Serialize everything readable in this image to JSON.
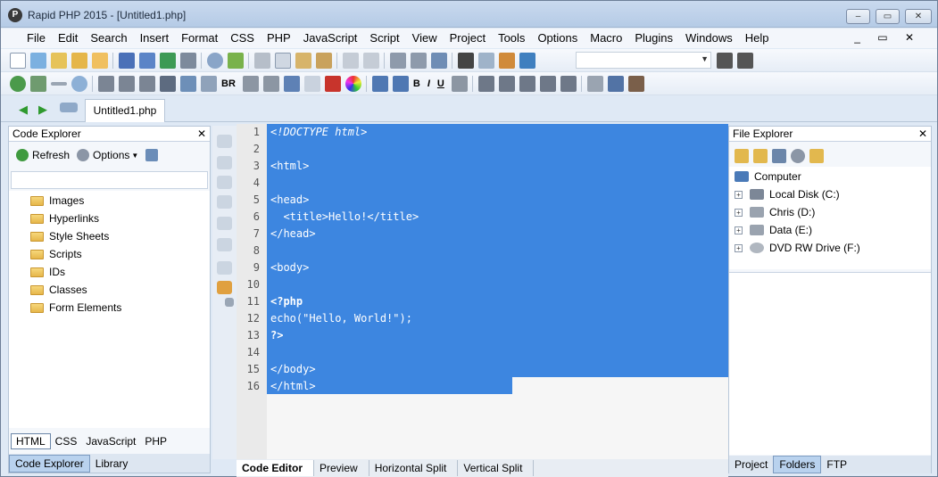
{
  "window": {
    "title": "Rapid PHP 2015 - [Untitled1.php]",
    "app_icon_letter": "P"
  },
  "window_controls": {
    "minimize": "–",
    "maximize": "▭",
    "close": "✕"
  },
  "menu": [
    "File",
    "Edit",
    "Search",
    "Insert",
    "Format",
    "CSS",
    "PHP",
    "JavaScript",
    "Script",
    "View",
    "Project",
    "Tools",
    "Options",
    "Macro",
    "Plugins",
    "Windows",
    "Help"
  ],
  "mdi_controls": "_ ▭ ✕",
  "toolbar2_text": {
    "br": "BR",
    "bold": "B",
    "italic": "I",
    "underline": "U"
  },
  "document_tab": "Untitled1.php",
  "code_explorer": {
    "title": "Code Explorer",
    "close": "✕",
    "refresh": "Refresh",
    "options": "Options",
    "items": [
      "Images",
      "Hyperlinks",
      "Style Sheets",
      "Scripts",
      "IDs",
      "Classes",
      "Form Elements"
    ],
    "lang_tabs": [
      "HTML",
      "CSS",
      "JavaScript",
      "PHP"
    ],
    "bottom_tabs": [
      "Code Explorer",
      "Library"
    ]
  },
  "editor": {
    "line_numbers": [
      "1",
      "2",
      "3",
      "4",
      "5",
      "6",
      "7",
      "8",
      "9",
      "10",
      "11",
      "12",
      "13",
      "14",
      "15",
      "16"
    ],
    "lines": [
      "<!DOCTYPE html>",
      "",
      "<html>",
      "",
      "<head>",
      "  <title>Hello!</title>",
      "</head>",
      "",
      "<body>",
      "",
      "<?php",
      "echo(\"Hello, World!\");",
      "?>",
      "",
      "</body>",
      "</html>"
    ],
    "tabs": [
      "Code Editor",
      "Preview",
      "Horizontal Split",
      "Vertical Split"
    ],
    "selection_color": "#3d86e0"
  },
  "file_explorer": {
    "title": "File Explorer",
    "close": "✕",
    "root": "Computer",
    "drives": [
      "Local Disk (C:)",
      "Chris (D:)",
      "Data (E:)",
      "DVD RW Drive (F:)"
    ],
    "expander": "+",
    "bottom_tabs": [
      "Project",
      "Folders",
      "FTP"
    ]
  }
}
